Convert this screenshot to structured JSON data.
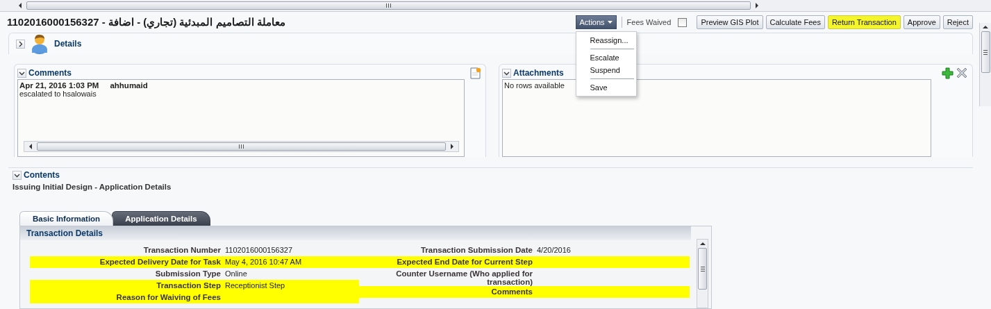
{
  "header": {
    "title": "معاملة التصاميم المبدئية (تجاري) - اضافة - 1102016000156327"
  },
  "toolbar": {
    "actions_label": "Actions",
    "menu": [
      {
        "label": "Reassign...",
        "separator_after": true
      },
      {
        "label": "Escalate",
        "separator_after": false
      },
      {
        "label": "Suspend",
        "separator_after": true
      },
      {
        "label": "Save",
        "separator_after": false
      }
    ],
    "fees_waived": {
      "label": "Fees Waived",
      "checked": false
    },
    "buttons": [
      {
        "label": "Preview GIS Plot",
        "highlighted": false
      },
      {
        "label": "Calculate Fees",
        "highlighted": false
      },
      {
        "label": "Return Transaction",
        "highlighted": true
      },
      {
        "label": "Approve",
        "highlighted": false
      },
      {
        "label": "Reject",
        "highlighted": false
      }
    ]
  },
  "details": {
    "label": "Details",
    "expanded": false
  },
  "comments": {
    "title": "Comments",
    "expanded": true,
    "entries": [
      {
        "date": "Apr 21, 2016 1:03 PM",
        "user": "ahhumaid",
        "text": "escalated to hsalowais"
      }
    ]
  },
  "attachments": {
    "title": "Attachments",
    "expanded": true,
    "empty_text": "No rows available"
  },
  "contents": {
    "title": "Contents",
    "expanded": true,
    "subtitle": "Issuing Initial Design - Application Details"
  },
  "tabs": [
    {
      "label": "Basic Information",
      "selected": true
    },
    {
      "label": "Application Details",
      "selected": false
    }
  ],
  "transaction_details": {
    "title": "Transaction Details",
    "left_fields": [
      {
        "label": "Transaction Number",
        "value": "1102016000156327",
        "highlighted": false
      },
      {
        "label": "Expected Delivery Date for Task",
        "value": "May 4, 2016 10:47 AM",
        "highlighted": true
      },
      {
        "label": "Submission Type",
        "value": "Online",
        "highlighted": false
      },
      {
        "label": "Transaction Step",
        "value": "Receptionist Step",
        "highlighted": true
      },
      {
        "label": "Reason for Waiving of Fees",
        "highlighted": true
      }
    ],
    "right_fields": [
      {
        "label": "Transaction Submission Date",
        "value": "4/20/2016",
        "highlighted": false
      },
      {
        "label": "Expected End Date for Current Step",
        "highlighted": true
      },
      {
        "label": "Counter Username (Who applied for transaction)",
        "highlighted": false
      },
      {
        "label": "Comments",
        "highlighted": true
      }
    ]
  }
}
